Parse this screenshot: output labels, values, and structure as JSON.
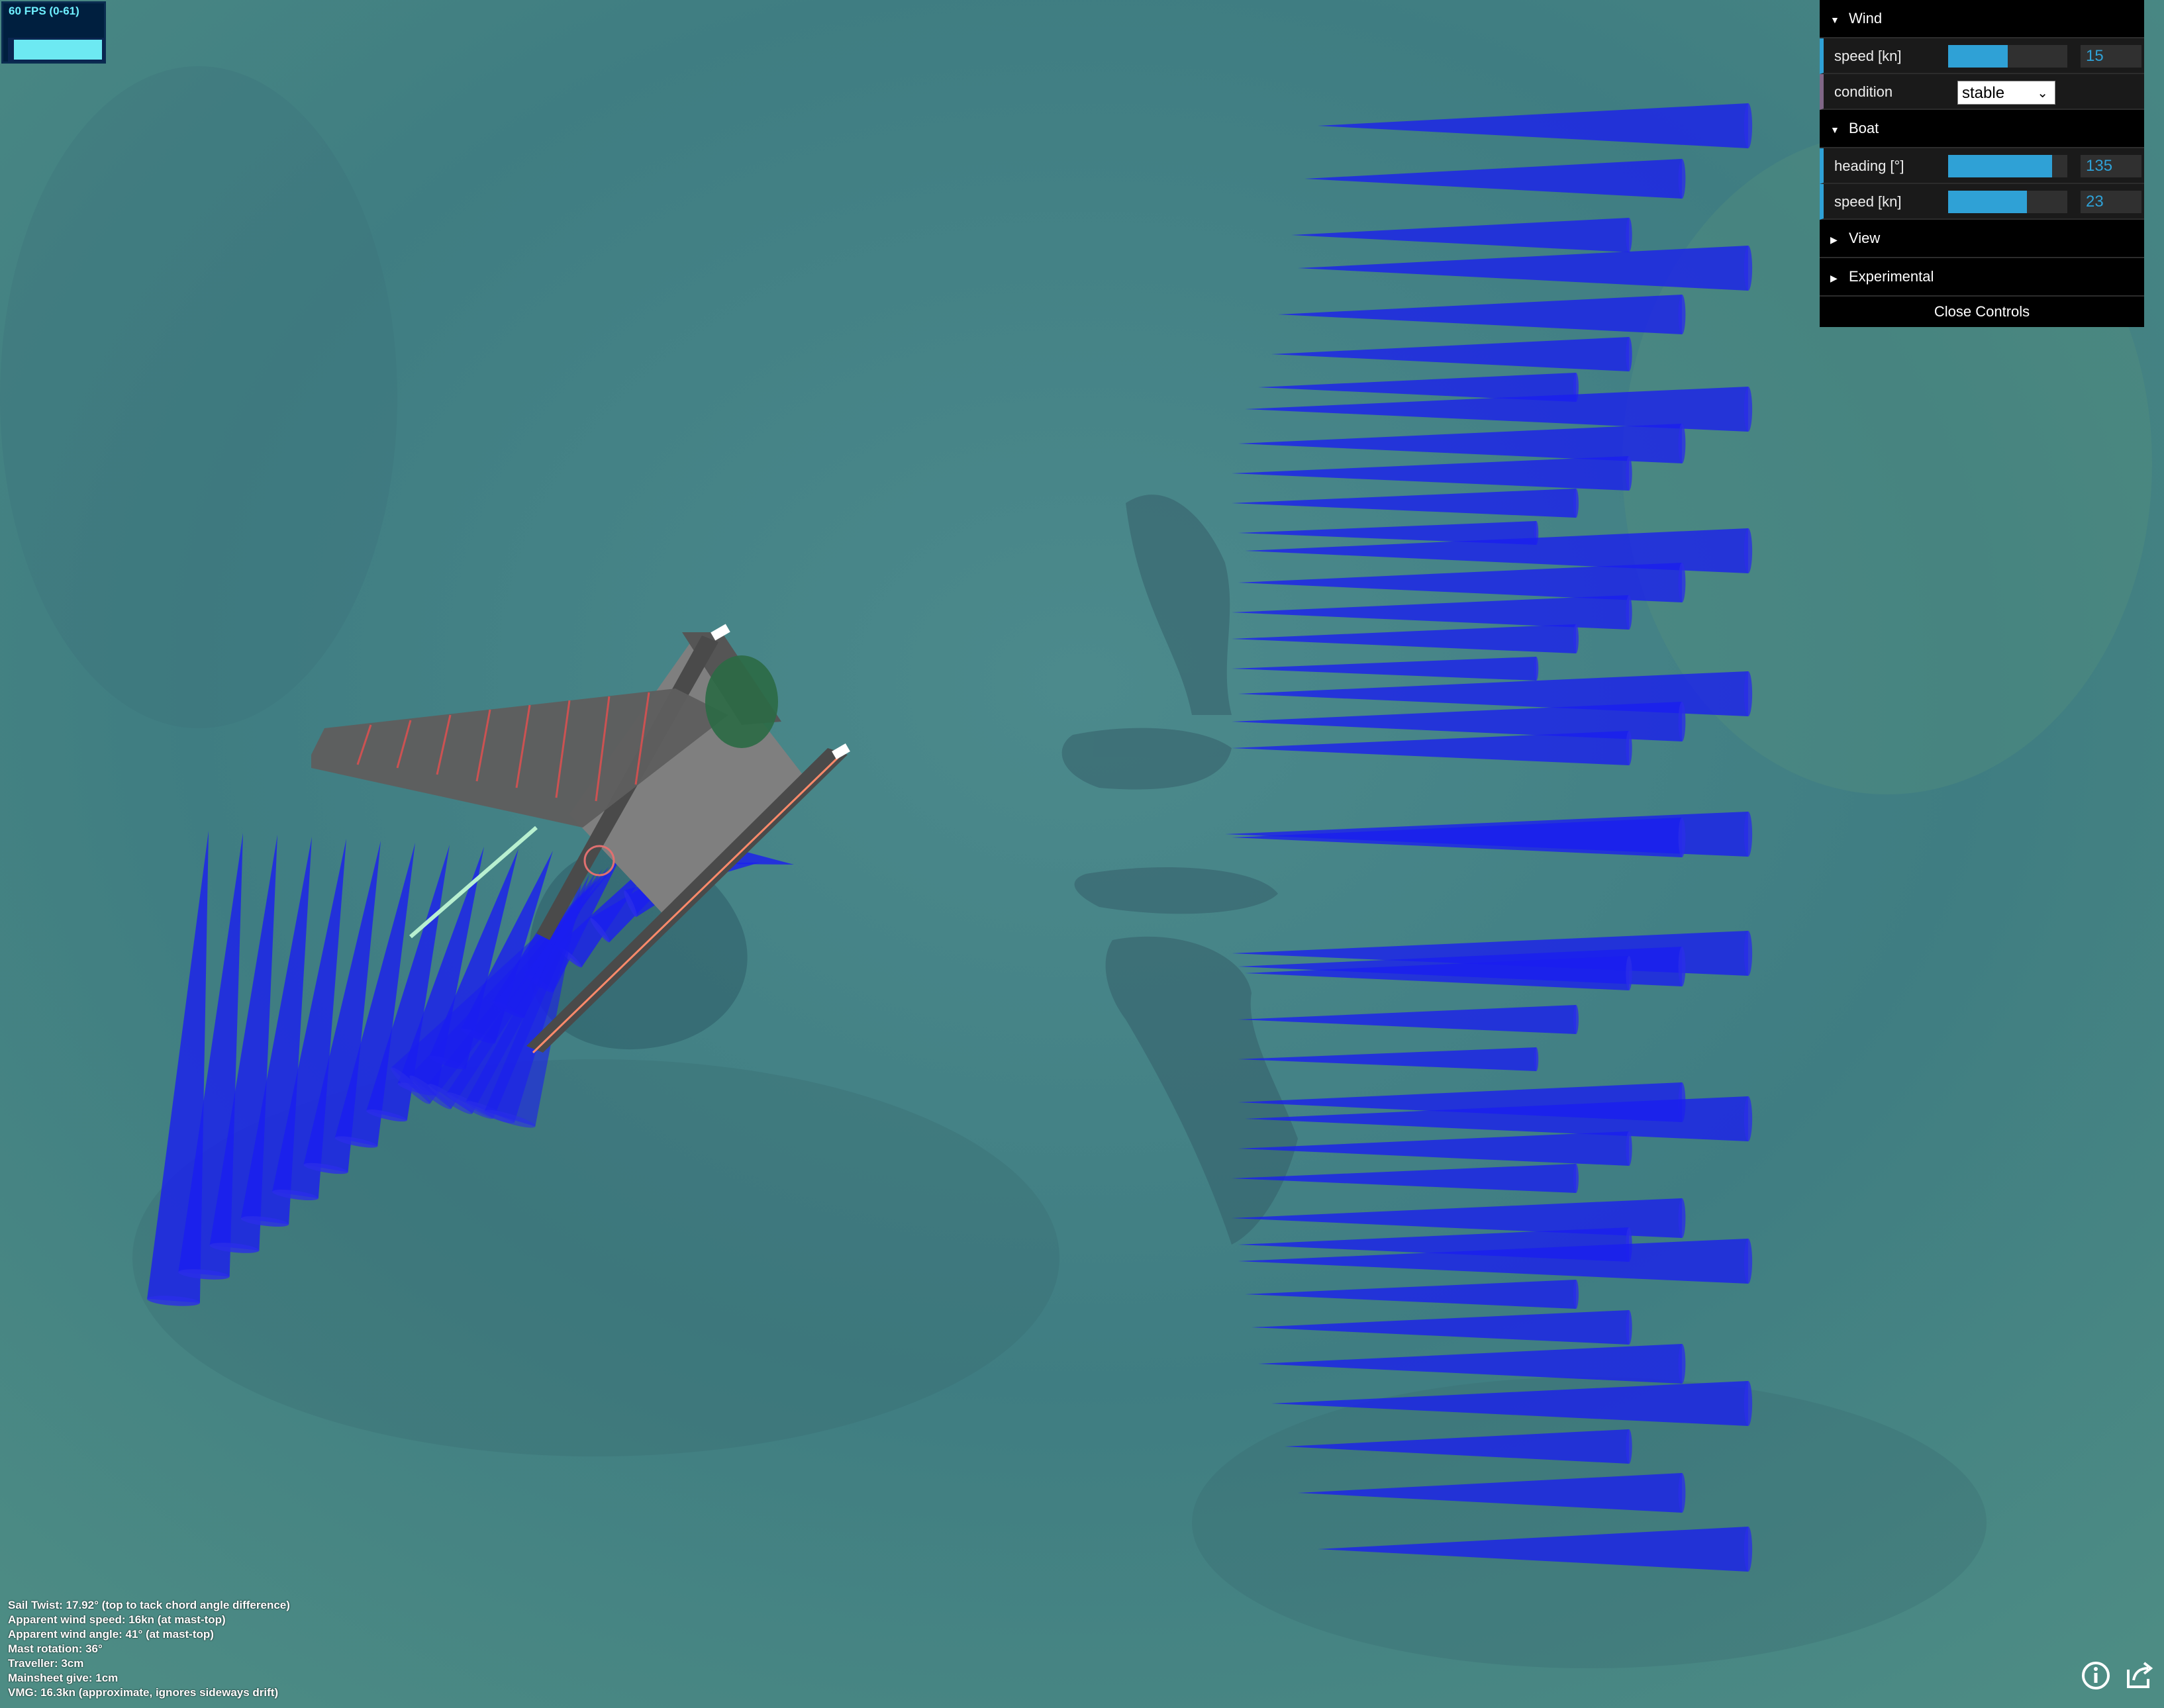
{
  "fps": {
    "label": "60 FPS (0-61)",
    "level": 0.95
  },
  "gui": {
    "wind": {
      "title": "Wind",
      "speed": {
        "label": "speed [kn]",
        "value": "15",
        "fraction": 0.5
      },
      "condition": {
        "label": "condition",
        "value": "stable"
      }
    },
    "boat": {
      "title": "Boat",
      "heading": {
        "label": "heading [°]",
        "value": "135",
        "fraction": 0.87
      },
      "speed": {
        "label": "speed [kn]",
        "value": "23",
        "fraction": 0.66
      }
    },
    "view": {
      "title": "View"
    },
    "experimental": {
      "title": "Experimental"
    },
    "close_label": "Close Controls"
  },
  "info_lines": [
    "Sail Twist: 17.92° (top to tack chord angle difference)",
    "Apparent wind speed: 16kn (at mast-top)",
    "Apparent wind angle: 41° (at mast-top)",
    "Mast rotation: 36°",
    "Traveller: 3cm",
    "Mainsheet give: 1cm",
    "VMG: 16.3kn (approximate, ignores sideways drift)"
  ],
  "colors": {
    "water": "#3f7a80",
    "cone": "#1a1ef0",
    "gui_accent": "#2fa1d6"
  },
  "icons": [
    "info-icon",
    "share-icon"
  ]
}
